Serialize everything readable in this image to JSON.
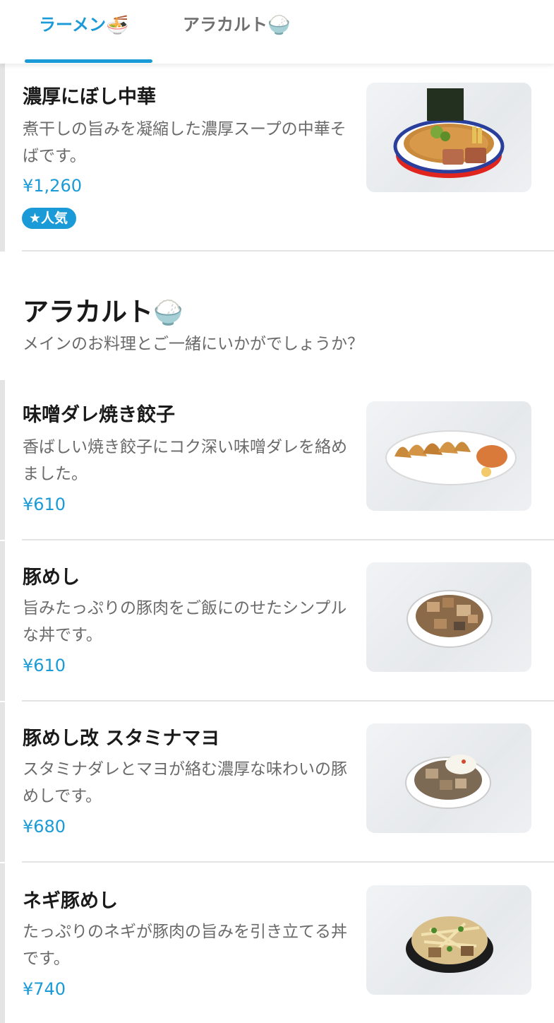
{
  "tabs": [
    {
      "label": "ラーメン",
      "emoji": "🍜"
    },
    {
      "label": "アラカルト",
      "emoji": "🍚"
    }
  ],
  "ramen_items": [
    {
      "name": "濃厚にぼし中華",
      "description": "煮干しの旨みを凝縮した濃厚スープの中華そばです。",
      "price": "¥1,260",
      "badge": "★人気"
    }
  ],
  "alacarte": {
    "title": "アラカルト",
    "emoji": "🍚",
    "description": "メインのお料理とご一緒にいかがでしょうか？",
    "items": [
      {
        "name": "味噌ダレ焼き餃子",
        "description": "香ばしい焼き餃子にコク深い味噌ダレを絡めました。",
        "price": "¥610"
      },
      {
        "name": "豚めし",
        "description": "旨みたっぷりの豚肉をご飯にのせたシンプルな丼です。",
        "price": "¥610"
      },
      {
        "name": "豚めし改 スタミナマヨ",
        "description": "スタミナダレとマヨが絡む濃厚な味わいの豚めしです。",
        "price": "¥680"
      },
      {
        "name": "ネギ豚めし",
        "description": "たっぷりのネギが豚肉の旨みを引き立てる丼です。",
        "price": "¥740"
      }
    ]
  },
  "colors": {
    "accent": "#1a9bd7",
    "text": "#1a1a1a",
    "muted": "#6a6a6a",
    "divider": "#e3e3e3"
  }
}
